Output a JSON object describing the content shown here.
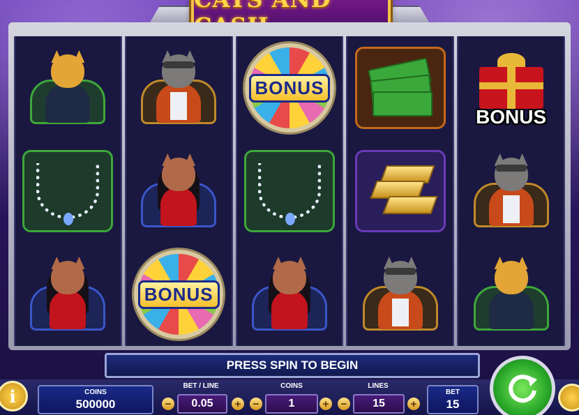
{
  "game": {
    "title": "CATS AND CASH"
  },
  "reels": [
    [
      "cat-tiger",
      "necklace",
      "cat-lady"
    ],
    [
      "cat-grey",
      "cat-lady",
      "bonus-wheel"
    ],
    [
      "bonus-wheel",
      "necklace",
      "cat-lady"
    ],
    [
      "cash-stack",
      "gold-bars",
      "cat-grey"
    ],
    [
      "bonus-gift",
      "cat-grey",
      "cat-tiger"
    ]
  ],
  "symbols": {
    "bonus_wheel_label": "BONUS",
    "bonus_gift_label": "BONUS"
  },
  "message": "PRESS SPIN TO BEGIN",
  "panel": {
    "coins_label": "COINS",
    "coins_value": "500000",
    "bet_line_label": "BET / LINE",
    "bet_line_value": "0.05",
    "coin_label": "COINS",
    "coin_value": "1",
    "lines_label": "LINES",
    "lines_value": "15",
    "bet_label": "BET",
    "bet_value": "15",
    "minus": "−",
    "plus": "+"
  },
  "buttons": {
    "info": "i"
  },
  "colors": {
    "spin": "#2aa82a",
    "panel": "#1a2a88",
    "gold": "#f3c24a"
  }
}
